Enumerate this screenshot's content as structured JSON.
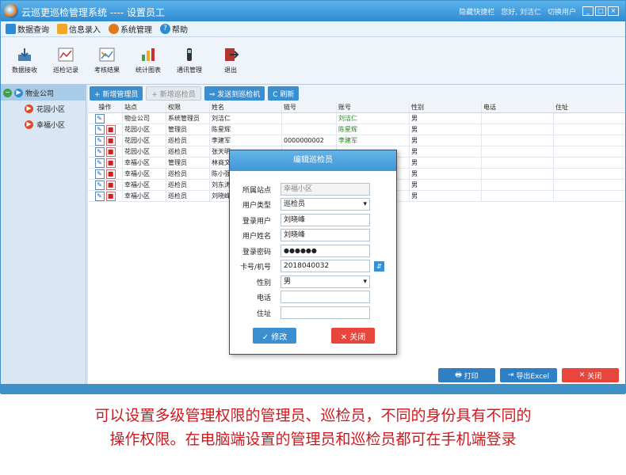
{
  "window": {
    "title": "云巡更巡检管理系统 ---- 设置员工",
    "right_items": [
      "隐藏快捷栏",
      "您好, 刘洁仁",
      "切换用户"
    ],
    "controls": [
      "_",
      "□",
      "×"
    ]
  },
  "menu": [
    {
      "label": "数据查询",
      "icon": "database-icon",
      "color": "#2f8bd1"
    },
    {
      "label": "信息录入",
      "icon": "form-icon",
      "color": "#f2a62c"
    },
    {
      "label": "系统管理",
      "icon": "gear-icon",
      "color": "#e07b1a"
    },
    {
      "label": "帮助",
      "icon": "help-icon",
      "color": "#2f8bd1"
    }
  ],
  "toolbar": [
    {
      "label": "数据接收",
      "icon": "download-icon"
    },
    {
      "label": "巡检记录",
      "icon": "record-chart-icon"
    },
    {
      "label": "考核结果",
      "icon": "assessment-icon"
    },
    {
      "label": "统计图表",
      "icon": "bar-chart-icon"
    },
    {
      "label": "通讯管理",
      "icon": "device-icon"
    },
    {
      "label": "退出",
      "icon": "exit-icon"
    }
  ],
  "tree": {
    "root": "物业公司",
    "children": [
      "花园小区",
      "幸福小区"
    ]
  },
  "actions": {
    "add_admin": "+ 新增管理员",
    "add_inspector": "+ 新增巡检员",
    "send": "⇒ 发送到巡检机",
    "refresh": "C 刷新"
  },
  "table": {
    "headers": [
      "操作",
      "站点",
      "权限",
      "姓名",
      "链号",
      "账号",
      "性别",
      "电话",
      "住址"
    ],
    "rows": [
      {
        "site": "物业公司",
        "role": "系统管理员",
        "name": "刘洁仁",
        "card": "",
        "account": "刘洁仁",
        "sex": "男",
        "phone": "",
        "addr": "",
        "deletable": false
      },
      {
        "site": "花园小区",
        "role": "管理员",
        "name": "陈星辉",
        "card": "",
        "account": "陈星辉",
        "sex": "男",
        "phone": "",
        "addr": "",
        "deletable": true
      },
      {
        "site": "花园小区",
        "role": "巡检员",
        "name": "李建军",
        "card": "0000000002",
        "account": "李建军",
        "sex": "男",
        "phone": "",
        "addr": "",
        "deletable": true
      },
      {
        "site": "花园小区",
        "role": "巡检员",
        "name": "张天明",
        "card": "",
        "account": "",
        "sex": "男",
        "phone": "",
        "addr": "",
        "deletable": true
      },
      {
        "site": "幸福小区",
        "role": "管理员",
        "name": "林商文",
        "card": "",
        "account": "",
        "sex": "男",
        "phone": "",
        "addr": "",
        "deletable": true
      },
      {
        "site": "幸福小区",
        "role": "巡检员",
        "name": "陈小强",
        "card": "",
        "account": "",
        "sex": "男",
        "phone": "",
        "addr": "",
        "deletable": true
      },
      {
        "site": "幸福小区",
        "role": "巡检员",
        "name": "刘东涛",
        "card": "",
        "account": "",
        "sex": "男",
        "phone": "",
        "addr": "",
        "deletable": true
      },
      {
        "site": "幸福小区",
        "role": "巡检员",
        "name": "刘晓峰",
        "card": "",
        "account": "",
        "sex": "男",
        "phone": "",
        "addr": "",
        "deletable": true
      }
    ]
  },
  "bottom_buttons": {
    "print": "打印",
    "export": "导出Excel",
    "close": "关闭"
  },
  "dialog": {
    "title": "编辑巡检员",
    "fields": {
      "site": {
        "label": "所属站点",
        "value": "幸福小区"
      },
      "type": {
        "label": "用户类型",
        "value": "巡检员"
      },
      "login": {
        "label": "登录用户",
        "value": "刘晓峰"
      },
      "name": {
        "label": "用户姓名",
        "value": "刘晓峰"
      },
      "password": {
        "label": "登录密码",
        "value": "●●●●●●"
      },
      "card": {
        "label": "卡号/机号",
        "value": "2018040032"
      },
      "sex": {
        "label": "性别",
        "value": "男"
      },
      "phone": {
        "label": "电话",
        "value": ""
      },
      "addr": {
        "label": "住址",
        "value": ""
      }
    },
    "modify_label": "✓ 修改",
    "close_label": "✕ 关闭"
  },
  "caption": [
    "可以设置多级管理权限的管理员、巡检员，不同的身份具有不同的",
    "操作权限。在电脑端设置的管理员和巡检员都可在手机端登录"
  ]
}
